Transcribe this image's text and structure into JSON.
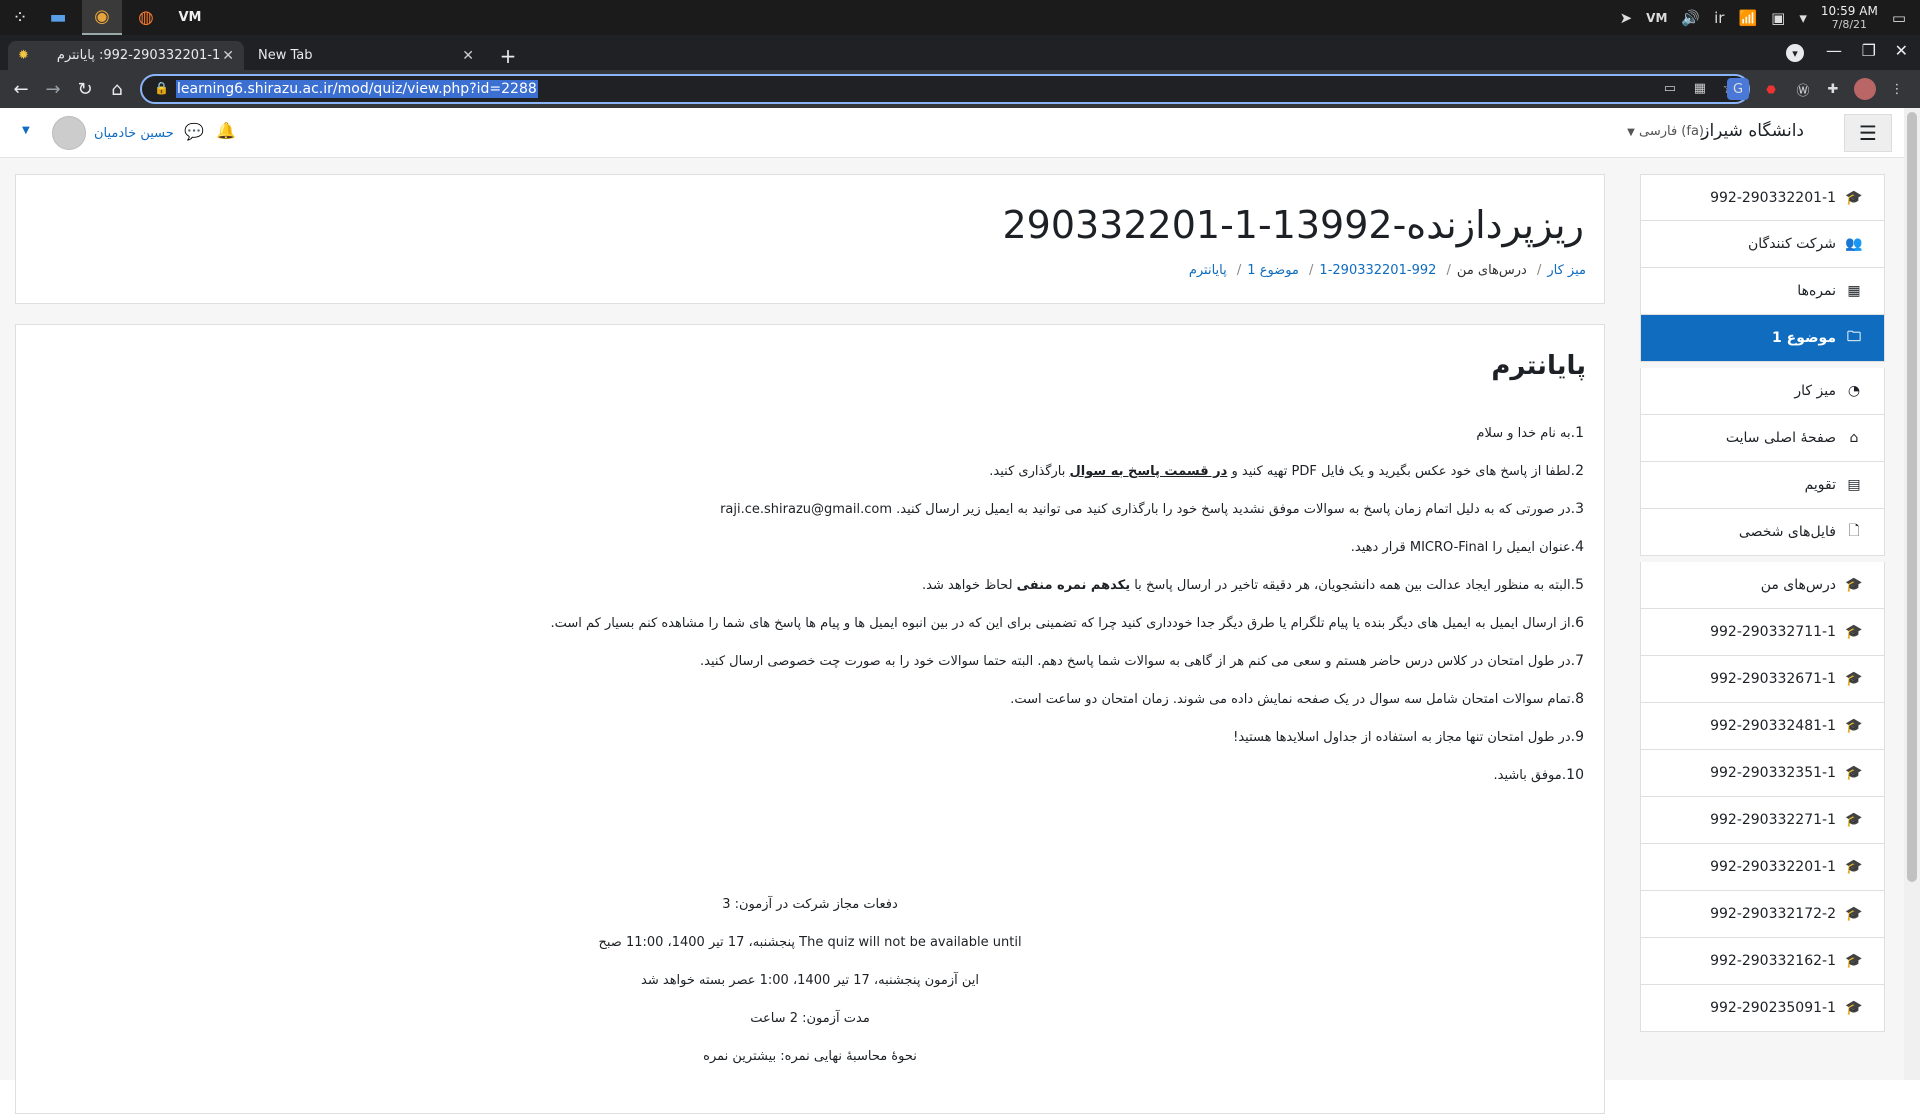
{
  "taskbar": {
    "time": "10:59 AM",
    "date": "7/8/21",
    "lang": "ir"
  },
  "browser": {
    "tabs": [
      {
        "title": "992-290332201-1: پایانترم"
      },
      {
        "title": "New Tab"
      }
    ],
    "url": "learning6.shirazu.ac.ir/mod/quiz/view.php?id=2288"
  },
  "navbar": {
    "site_name": "دانشگاه شیراز",
    "language": "فارسی ‎(fa)‎",
    "user_name": "حسین خادمیان"
  },
  "header": {
    "title": "ریزپردازنده-13992-1-290332201",
    "breadcrumb": [
      "میز کار",
      "درس‌های من",
      "992-290332201-1",
      "موضوع 1",
      "پایانترم"
    ]
  },
  "quiz": {
    "title": "پایانترم",
    "rules": [
      {
        "num": "1.",
        "text": "به نام خدا و سلام"
      },
      {
        "num": "2.",
        "text": "لطفا از پاسخ های خود عکس بگیرید و یک فایل PDF تهیه کنید و ",
        "bold": "در قسمت پاسخ به سوال",
        "tail": " بارگذاری کنید."
      },
      {
        "num": "3.",
        "text": "در صورتی که به دلیل اتمام زمان پاسخ به سوالات موفق نشدید پاسخ خود را بارگذاری کنید می توانید به ایمیل زیر ارسال کنید. raji.ce.shirazu@gmail.com"
      },
      {
        "num": "4.",
        "text": "عنوان ایمیل را MICRO-Final قرار دهید."
      },
      {
        "num": "5.",
        "text": "البته به منظور ایجاد عدالت بین همه دانشجویان، هر دقیقه تاخیر در ارسال پاسخ با ",
        "bold": "یکدهم نمره منفی",
        "tail": " لحاظ خواهد شد."
      },
      {
        "num": "6.",
        "text": "از ارسال ایمیل به ایمیل های دیگر بنده یا پیام تلگرام یا طرق دیگر جدا خودداری کنید چرا که تضمینی برای این که در بین انبوه ایمیل ها و پیام ها پاسخ های شما را مشاهده کنم بسیار کم است."
      },
      {
        "num": "7.",
        "text": "در طول امتحان در کلاس درس حاضر هستم و سعی می کنم هر از گاهی به سوالات شما پاسخ دهم. البته حتما سوالات خود را به صورت چت خصوصی ارسال کنید."
      },
      {
        "num": "8.",
        "text": "تمام سوالات امتحان شامل سه سوال در یک صفحه نمایش داده می شوند. زمان امتحان دو ساعت است."
      },
      {
        "num": "9.",
        "text": "در طول امتحان تنها مجاز به استفاده از جداول اسلایدها هستید!"
      },
      {
        "num": "10.",
        "text": "موفق باشید."
      }
    ],
    "info": [
      "دفعات مجاز شرکت در آزمون: 3",
      "The quiz will not be available until پنجشنبه، 17 تیر 1400، 11:00 صبح",
      "این آزمون پنجشنبه، 17 تیر 1400، 1:00 عصر بسته خواهد شد",
      "مدت آزمون: 2 ساعت",
      "نحوهٔ محاسبهٔ نهایی نمره: بیشترین نمره"
    ]
  },
  "sidebar": {
    "items": [
      {
        "label": "992-290332201-1",
        "icon": "graduation-cap-icon",
        "glyph": "🎓"
      },
      {
        "label": "شرکت کنندگان",
        "icon": "users-icon",
        "glyph": "👥"
      },
      {
        "label": "نمره‌ها",
        "icon": "table-icon",
        "glyph": "▦"
      },
      {
        "label": "موضوع 1",
        "icon": "folder-icon",
        "glyph": "🗀",
        "active": true
      },
      {
        "label": "میز کار",
        "icon": "dashboard-icon",
        "glyph": "◔"
      },
      {
        "label": "صفحهٔ اصلی سایت",
        "icon": "home-icon",
        "glyph": "⌂"
      },
      {
        "label": "تقویم",
        "icon": "calendar-icon",
        "glyph": "▤"
      },
      {
        "label": "فایل‌های شخصی",
        "icon": "file-icon",
        "glyph": "🗋"
      },
      {
        "label": "درس‌های من",
        "icon": "graduation-cap-icon",
        "glyph": "🎓"
      },
      {
        "label": "992-290332711-1",
        "icon": "graduation-cap-icon",
        "glyph": "🎓"
      },
      {
        "label": "992-290332671-1",
        "icon": "graduation-cap-icon",
        "glyph": "🎓"
      },
      {
        "label": "992-290332481-1",
        "icon": "graduation-cap-icon",
        "glyph": "🎓"
      },
      {
        "label": "992-290332351-1",
        "icon": "graduation-cap-icon",
        "glyph": "🎓"
      },
      {
        "label": "992-290332271-1",
        "icon": "graduation-cap-icon",
        "glyph": "🎓"
      },
      {
        "label": "992-290332201-1",
        "icon": "graduation-cap-icon",
        "glyph": "🎓"
      },
      {
        "label": "992-290332172-2",
        "icon": "graduation-cap-icon",
        "glyph": "🎓"
      },
      {
        "label": "992-290332162-1",
        "icon": "graduation-cap-icon",
        "glyph": "🎓"
      },
      {
        "label": "992-290235091-1",
        "icon": "graduation-cap-icon",
        "glyph": "🎓"
      }
    ]
  },
  "colors": {
    "primary": "#0f6cbf",
    "chrome_dark": "#202124"
  }
}
